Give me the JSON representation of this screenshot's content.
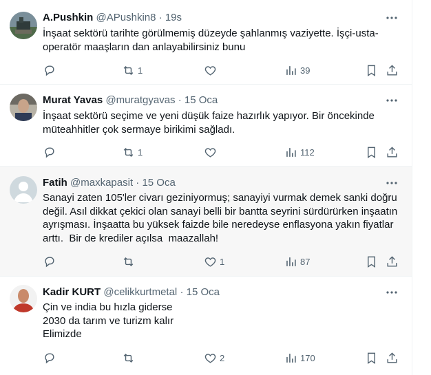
{
  "tweets": [
    {
      "name": "A.Pushkin",
      "handle": "@APushkin8",
      "separator": "·",
      "time": "19s",
      "text": "İnşaat sektörü tarihte görülmemiş düzeyde şahlanmış vaziyette. İşçi-usta-operatör maaşların dan anlayabilirsiniz bunu",
      "replies": "",
      "retweets": "1",
      "likes": "",
      "views": "39",
      "like_color": "#536471",
      "avatar": "statue-photo-icon"
    },
    {
      "name": "Murat Yavas",
      "handle": "@muratgyavas",
      "separator": "·",
      "time": "15 Oca",
      "text": "İnşaat sektörü seçime ve yeni düşük faize hazırlık yapıyor. Bir öncekinde müteahhitler çok sermaye birikimi sağladı.",
      "replies": "",
      "retweets": "1",
      "likes": "",
      "views": "112",
      "avatar": "portrait-photo-icon"
    },
    {
      "name": "Fatih",
      "handle": "@maxkapasit",
      "separator": "·",
      "time": "15 Oca",
      "text": "Sanayi zaten 105'ler civarı geziniyormuş; sanayiyi vurmak demek sanki doğru değil. Asıl dikkat çekici olan sanayi belli bir bantta seyrini sürdürürken inşaatın ayrışması. İnşaatta bu yüksek faizde bile neredeyse enflasyona yakın fiyatlar arttı.  Bir de krediler açılsa  maazallah!",
      "replies": "",
      "retweets": "",
      "likes": "1",
      "views": "87",
      "avatar": "default-avatar-icon"
    },
    {
      "name": "Kadir KURT",
      "handle": "@celikkurtmetal",
      "separator": "·",
      "time": "15 Oca",
      "text": "Çin ve india bu hızla giderse\n2030 da tarım ve turizm kalır\nElimizde",
      "replies": "",
      "retweets": "",
      "likes": "2",
      "views": "170",
      "avatar": "man-portrait-photo-icon"
    }
  ],
  "colors": {
    "text": "#0f1419",
    "secondary": "#536471",
    "border": "#eff3f4",
    "highlight_bg": "#f7f7f7"
  }
}
